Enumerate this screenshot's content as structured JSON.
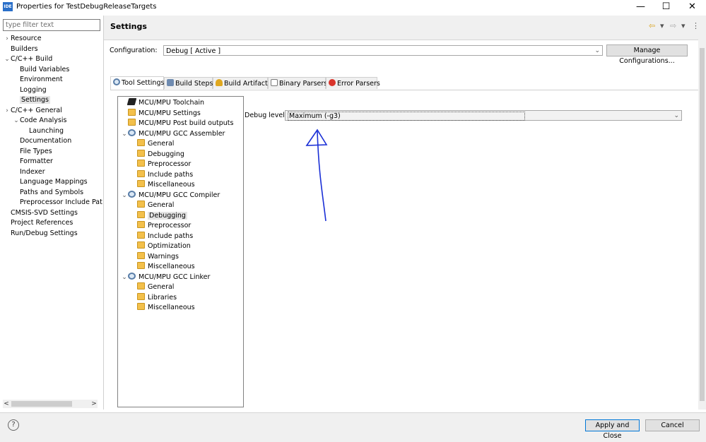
{
  "window": {
    "title": "Properties for TestDebugReleaseTargets",
    "app_icon_text": "IDE",
    "minimize_glyph": "—",
    "maximize_glyph": "☐",
    "close_glyph": "✕"
  },
  "filter": {
    "placeholder": "type filter text"
  },
  "nav": {
    "items": [
      {
        "label": "Resource",
        "twisty": "›"
      },
      {
        "label": "Builders",
        "twisty": ""
      },
      {
        "label": "C/C++ Build",
        "twisty": "⌄"
      },
      {
        "label": "Build Variables",
        "twisty": ""
      },
      {
        "label": "Environment",
        "twisty": ""
      },
      {
        "label": "Logging",
        "twisty": ""
      },
      {
        "label": "Settings",
        "twisty": ""
      },
      {
        "label": "C/C++ General",
        "twisty": "›"
      },
      {
        "label": "Code Analysis",
        "twisty": "⌄"
      },
      {
        "label": "Launching",
        "twisty": ""
      },
      {
        "label": "Documentation",
        "twisty": ""
      },
      {
        "label": "File Types",
        "twisty": ""
      },
      {
        "label": "Formatter",
        "twisty": ""
      },
      {
        "label": "Indexer",
        "twisty": ""
      },
      {
        "label": "Language Mappings",
        "twisty": ""
      },
      {
        "label": "Paths and Symbols",
        "twisty": ""
      },
      {
        "label": "Preprocessor Include Pat",
        "twisty": ""
      },
      {
        "label": "CMSIS-SVD Settings",
        "twisty": ""
      },
      {
        "label": "Project References",
        "twisty": ""
      },
      {
        "label": "Run/Debug Settings",
        "twisty": ""
      }
    ],
    "scroll_left": "<",
    "scroll_right": ">"
  },
  "header": {
    "title": "Settings",
    "back_icon": "⇦",
    "forward_icon": "⇨",
    "dropdown_icon": "▾",
    "menu_icon": "⋮"
  },
  "configuration": {
    "label": "Configuration:",
    "value": "Debug  [ Active ]",
    "manage_label": "Manage Configurations..."
  },
  "tabs": [
    {
      "label": "Tool Settings",
      "icon": "gear-icon",
      "color": "#5a7ea8"
    },
    {
      "label": "Build Steps",
      "icon": "steps-icon",
      "color": "#6f8bb0"
    },
    {
      "label": "Build Artifact",
      "icon": "trophy-icon",
      "color": "#e0a81f"
    },
    {
      "label": "Binary Parsers",
      "icon": "binary-icon",
      "color": "#7a7a7a"
    },
    {
      "label": "Error Parsers",
      "icon": "error-icon",
      "color": "#d9342b"
    }
  ],
  "tool_tree": [
    {
      "label": "MCU/MPU Toolchain",
      "twisty": "",
      "icon": "chip",
      "depth": 0
    },
    {
      "label": "MCU/MPU Settings",
      "twisty": "",
      "icon": "folder",
      "depth": 0
    },
    {
      "label": "MCU/MPU Post build outputs",
      "twisty": "",
      "icon": "folder",
      "depth": 0
    },
    {
      "label": "MCU/MPU GCC Assembler",
      "twisty": "⌄",
      "icon": "gear",
      "depth": 0
    },
    {
      "label": "General",
      "twisty": "",
      "icon": "folder",
      "depth": 1
    },
    {
      "label": "Debugging",
      "twisty": "",
      "icon": "folder",
      "depth": 1
    },
    {
      "label": "Preprocessor",
      "twisty": "",
      "icon": "folder",
      "depth": 1
    },
    {
      "label": "Include paths",
      "twisty": "",
      "icon": "folder",
      "depth": 1
    },
    {
      "label": "Miscellaneous",
      "twisty": "",
      "icon": "folder",
      "depth": 1
    },
    {
      "label": "MCU/MPU GCC Compiler",
      "twisty": "⌄",
      "icon": "gear",
      "depth": 0
    },
    {
      "label": "General",
      "twisty": "",
      "icon": "folder",
      "depth": 1
    },
    {
      "label": "Debugging",
      "twisty": "",
      "icon": "folder",
      "depth": 1
    },
    {
      "label": "Preprocessor",
      "twisty": "",
      "icon": "folder",
      "depth": 1
    },
    {
      "label": "Include paths",
      "twisty": "",
      "icon": "folder",
      "depth": 1
    },
    {
      "label": "Optimization",
      "twisty": "",
      "icon": "folder",
      "depth": 1
    },
    {
      "label": "Warnings",
      "twisty": "",
      "icon": "folder",
      "depth": 1
    },
    {
      "label": "Miscellaneous",
      "twisty": "",
      "icon": "folder",
      "depth": 1
    },
    {
      "label": "MCU/MPU GCC Linker",
      "twisty": "⌄",
      "icon": "gear",
      "depth": 0
    },
    {
      "label": "General",
      "twisty": "",
      "icon": "folder",
      "depth": 1
    },
    {
      "label": "Libraries",
      "twisty": "",
      "icon": "folder",
      "depth": 1
    },
    {
      "label": "Miscellaneous",
      "twisty": "",
      "icon": "folder",
      "depth": 1
    }
  ],
  "debug": {
    "label": "Debug level",
    "value": "Maximum (-g3)"
  },
  "annotation": {
    "color": "#1a2fd6"
  },
  "buttons": {
    "apply_close": "Apply and Close",
    "cancel": "Cancel",
    "help": "?"
  }
}
